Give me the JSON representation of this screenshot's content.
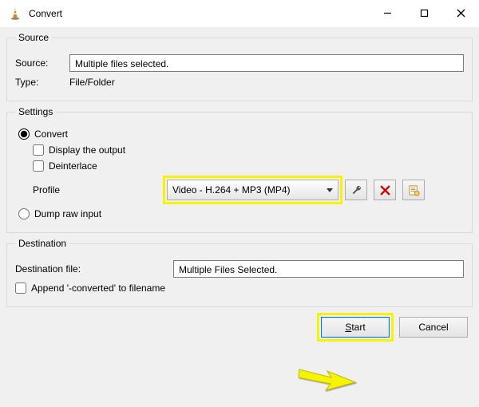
{
  "titlebar": {
    "title": "Convert"
  },
  "source": {
    "legend": "Source",
    "source_label": "Source:",
    "source_value": "Multiple files selected.",
    "type_label": "Type:",
    "type_value": "File/Folder"
  },
  "settings": {
    "legend": "Settings",
    "convert_label": "Convert",
    "display_output_label": "Display the output",
    "deinterlace_label": "Deinterlace",
    "profile_label": "Profile",
    "profile_value": "Video - H.264 + MP3 (MP4)",
    "dump_raw_label": "Dump raw input"
  },
  "destination": {
    "legend": "Destination",
    "dest_label": "Destination file:",
    "dest_value": "Multiple Files Selected.",
    "append_label": "Append '-converted' to filename"
  },
  "buttons": {
    "start": "Start",
    "cancel": "Cancel"
  },
  "icons": {
    "wrench": "wrench-icon",
    "delete": "delete-icon",
    "new": "new-profile-icon"
  }
}
